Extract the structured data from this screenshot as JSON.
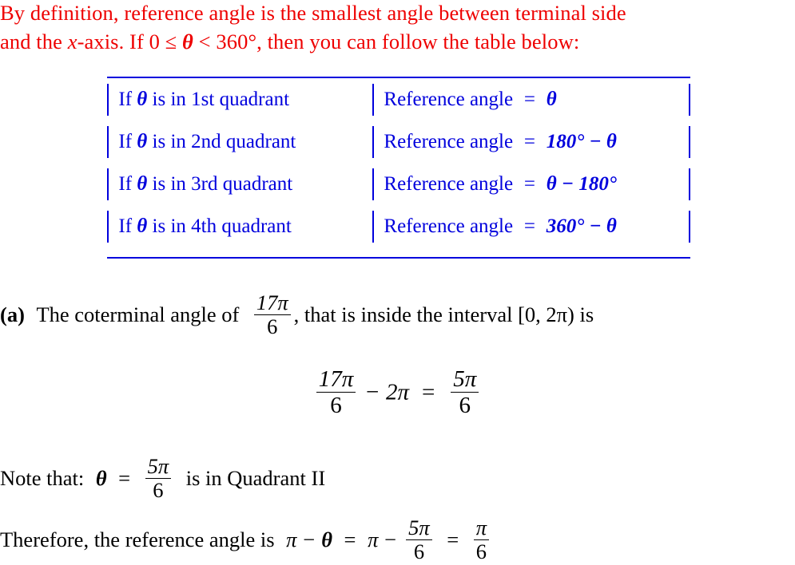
{
  "colors": {
    "intro_text": "#ee0000",
    "table_text": "#0000dd",
    "body_text": "#000000",
    "background": "#ffffff"
  },
  "intro": {
    "line1": "By definition, reference angle is the smallest angle between terminal side",
    "line2_part1": "and the ",
    "line2_var": "x",
    "line2_part2": "-axis. If 0 ≤ ",
    "line2_theta": "θ",
    "line2_part3": " < 360°, then you can follow the table below:"
  },
  "table": {
    "rows": [
      {
        "condition_prefix": "If ",
        "condition_symbol": "θ",
        "condition_suffix": " is in 1st quadrant",
        "result_label": "Reference angle",
        "result_equals": "=",
        "result_expression": "θ",
        "quadrant": "1st"
      },
      {
        "condition_prefix": "If ",
        "condition_symbol": "θ",
        "condition_suffix": " is in 2nd quadrant",
        "result_label": "Reference angle",
        "result_equals": "=",
        "result_expression": "180° − θ",
        "quadrant": "2nd"
      },
      {
        "condition_prefix": "If ",
        "condition_symbol": "θ",
        "condition_suffix": " is in 3rd quadrant",
        "result_label": "Reference angle",
        "result_equals": "=",
        "result_expression": "θ − 180°",
        "quadrant": "3rd"
      },
      {
        "condition_prefix": "If ",
        "condition_symbol": "θ",
        "condition_suffix": " is in 4th quadrant",
        "result_label": "Reference angle",
        "result_equals": "=",
        "result_expression": "360° − θ",
        "quadrant": "4th"
      }
    ]
  },
  "part_a": {
    "label": "(a)",
    "text_before": "The coterminal angle of",
    "fraction": {
      "numerator": "17π",
      "denominator": "6"
    },
    "text_after": ", that is inside the interval [0, 2π) is",
    "interval": "[0, 2π)"
  },
  "display_equation": {
    "lhs_fraction": {
      "numerator": "17π",
      "denominator": "6"
    },
    "minus": "−",
    "subtrahend": "2π",
    "equals": "=",
    "rhs_fraction": {
      "numerator": "5π",
      "denominator": "6"
    },
    "full_text": "17π/6 − 2π = 5π/6"
  },
  "note": {
    "text_before": "Note that:",
    "theta": "θ",
    "equals": "=",
    "fraction": {
      "numerator": "5π",
      "denominator": "6"
    },
    "text_after": "is in Quadrant II",
    "quadrant": "II"
  },
  "therefore": {
    "text_before": "Therefore, the reference angle is",
    "expr1_pi": "π",
    "expr1_minus": "−",
    "expr1_theta": "θ",
    "equals1": "=",
    "expr2_pi": "π",
    "expr2_minus": "−",
    "fraction1": {
      "numerator": "5π",
      "denominator": "6"
    },
    "equals2": "=",
    "fraction2": {
      "numerator": "π",
      "denominator": "6"
    },
    "full_text": "Therefore, the reference angle is π − θ = π − 5π/6 = π/6"
  }
}
